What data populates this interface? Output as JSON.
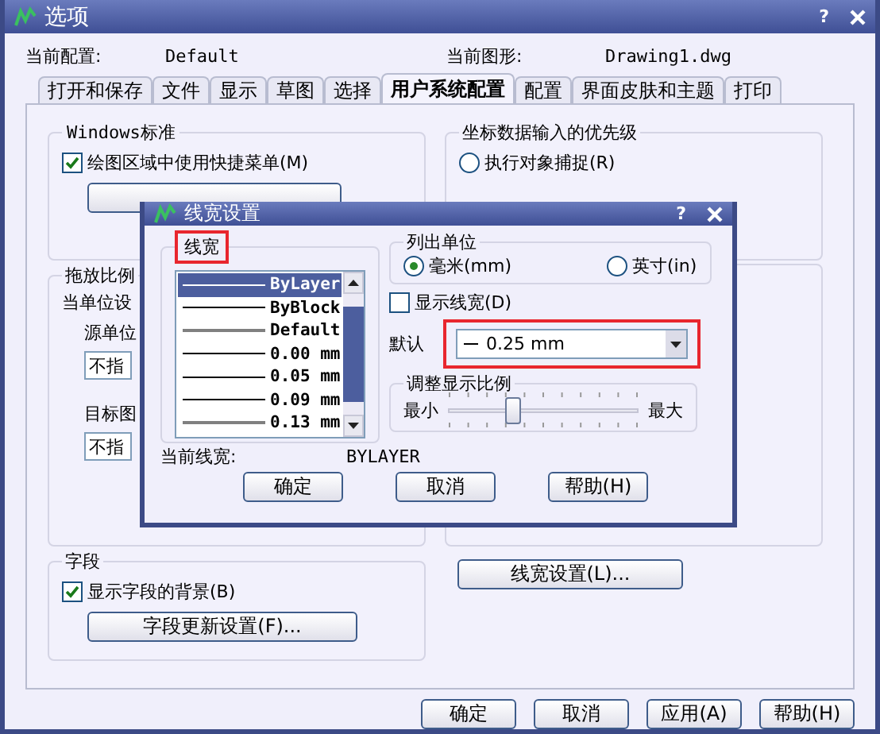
{
  "window": {
    "title": "选项",
    "help": "?"
  },
  "header": {
    "profile_label": "当前配置:",
    "profile": "Default",
    "drawing_label": "当前图形:",
    "drawing": "Drawing1.dwg"
  },
  "tabs": [
    {
      "label": "打开和保存",
      "selected": false
    },
    {
      "label": "文件",
      "selected": false
    },
    {
      "label": "显示",
      "selected": false
    },
    {
      "label": "草图",
      "selected": false
    },
    {
      "label": "选择",
      "selected": false
    },
    {
      "label": "用户系统配置",
      "selected": true
    },
    {
      "label": "配置",
      "selected": false
    },
    {
      "label": "界面皮肤和主题",
      "selected": false
    },
    {
      "label": "打印",
      "selected": false
    }
  ],
  "windows_standard": {
    "title": "Windows标准",
    "checkbox": {
      "label": "绘图区域中使用快捷菜单(M)",
      "checked": true
    }
  },
  "coordinate_priority": {
    "title": "坐标数据输入的优先级",
    "options": [
      {
        "label": "执行对象捕捉(R)",
        "selected": false
      }
    ]
  },
  "insert_scale": {
    "title": "拖放比例",
    "caption": "当单位设",
    "source_label": "源单位",
    "source_value": "不指",
    "target_label": "目标图",
    "target_value": "不指"
  },
  "fields": {
    "title": "字段",
    "checkbox": {
      "label": "显示字段的背景(B)",
      "checked": true
    },
    "button": "字段更新设置(F)..."
  },
  "lineweight_button": "线宽设置(L)...",
  "buttons": [
    "确定",
    "取消",
    "应用(A)",
    "帮助(H)"
  ],
  "lineweight_dialog": {
    "title": "线宽设置",
    "help": "?",
    "list_title": "线宽",
    "items": [
      {
        "label": "ByLayer",
        "selected": true
      },
      {
        "label": "ByBlock",
        "selected": false
      },
      {
        "label": "Default",
        "selected": false
      },
      {
        "label": "0.00 mm",
        "selected": false
      },
      {
        "label": "0.05 mm",
        "selected": false
      },
      {
        "label": "0.09 mm",
        "selected": false
      },
      {
        "label": "0.13 mm",
        "selected": false
      }
    ],
    "units_title": "列出单位",
    "units": [
      {
        "label": "毫米(mm)",
        "selected": true
      },
      {
        "label": "英寸(in)",
        "selected": false
      }
    ],
    "display_checkbox": {
      "label": "显示线宽(D)",
      "checked": false
    },
    "default_label": "默认",
    "default_value": "0.25 mm",
    "scale_title": "调整显示比例",
    "scale_min": "最小",
    "scale_max": "最大",
    "scale": {
      "level": 0.34
    },
    "current_label": "当前线宽:",
    "current_value": "BYLAYER",
    "buttons": [
      "确定",
      "取消",
      "帮助(H)"
    ]
  }
}
